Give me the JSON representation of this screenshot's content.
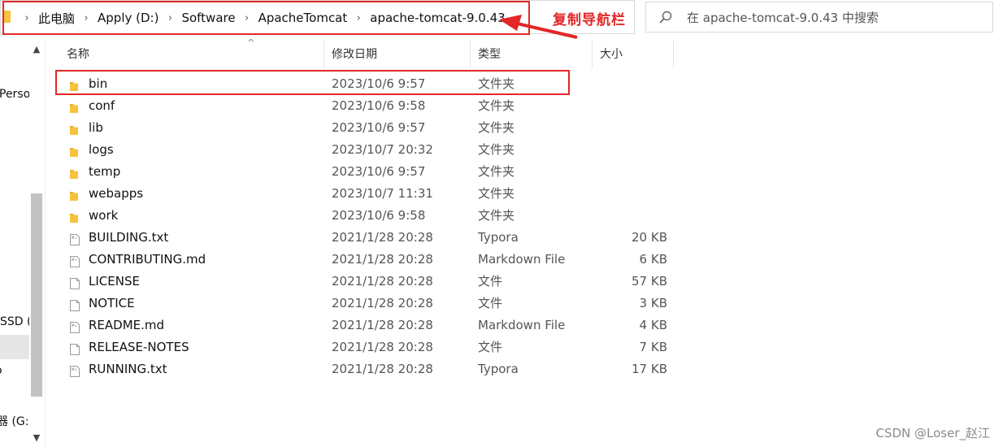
{
  "address_bar": {
    "breadcrumbs": [
      "此电脑",
      "Apply (D:)",
      "Software",
      "ApacheTomcat",
      "apache-tomcat-9.0.43"
    ],
    "annotation": "复制导航栏"
  },
  "search": {
    "placeholder": "在 apache-tomcat-9.0.43 中搜索"
  },
  "nav": {
    "items": [
      "Perso",
      "SSD (",
      "o",
      "器 (G:)"
    ]
  },
  "columns": {
    "name": "名称",
    "date": "修改日期",
    "type": "类型",
    "size": "大小"
  },
  "files": [
    {
      "name": "bin",
      "date": "2023/10/6 9:57",
      "type": "文件夹",
      "size": "",
      "icon": "folder-icon"
    },
    {
      "name": "conf",
      "date": "2023/10/6 9:58",
      "type": "文件夹",
      "size": "",
      "icon": "folder-icon"
    },
    {
      "name": "lib",
      "date": "2023/10/6 9:57",
      "type": "文件夹",
      "size": "",
      "icon": "folder-icon"
    },
    {
      "name": "logs",
      "date": "2023/10/7 20:32",
      "type": "文件夹",
      "size": "",
      "icon": "folder-icon"
    },
    {
      "name": "temp",
      "date": "2023/10/6 9:57",
      "type": "文件夹",
      "size": "",
      "icon": "folder-icon"
    },
    {
      "name": "webapps",
      "date": "2023/10/7 11:31",
      "type": "文件夹",
      "size": "",
      "icon": "folder-icon"
    },
    {
      "name": "work",
      "date": "2023/10/6 9:58",
      "type": "文件夹",
      "size": "",
      "icon": "folder-icon"
    },
    {
      "name": "BUILDING.txt",
      "date": "2021/1/28 20:28",
      "type": "Typora",
      "size": "20 KB",
      "icon": "markdown-file-icon"
    },
    {
      "name": "CONTRIBUTING.md",
      "date": "2021/1/28 20:28",
      "type": "Markdown File",
      "size": "6 KB",
      "icon": "markdown-file-icon"
    },
    {
      "name": "LICENSE",
      "date": "2021/1/28 20:28",
      "type": "文件",
      "size": "57 KB",
      "icon": "blank-file-icon"
    },
    {
      "name": "NOTICE",
      "date": "2021/1/28 20:28",
      "type": "文件",
      "size": "3 KB",
      "icon": "blank-file-icon"
    },
    {
      "name": "README.md",
      "date": "2021/1/28 20:28",
      "type": "Markdown File",
      "size": "4 KB",
      "icon": "markdown-file-icon"
    },
    {
      "name": "RELEASE-NOTES",
      "date": "2021/1/28 20:28",
      "type": "文件",
      "size": "7 KB",
      "icon": "blank-file-icon"
    },
    {
      "name": "RUNNING.txt",
      "date": "2021/1/28 20:28",
      "type": "Typora",
      "size": "17 KB",
      "icon": "markdown-file-icon"
    }
  ],
  "watermark": "CSDN @Loser_赵江",
  "colors": {
    "highlight": "#e32626",
    "folder": "#f6c33c"
  }
}
